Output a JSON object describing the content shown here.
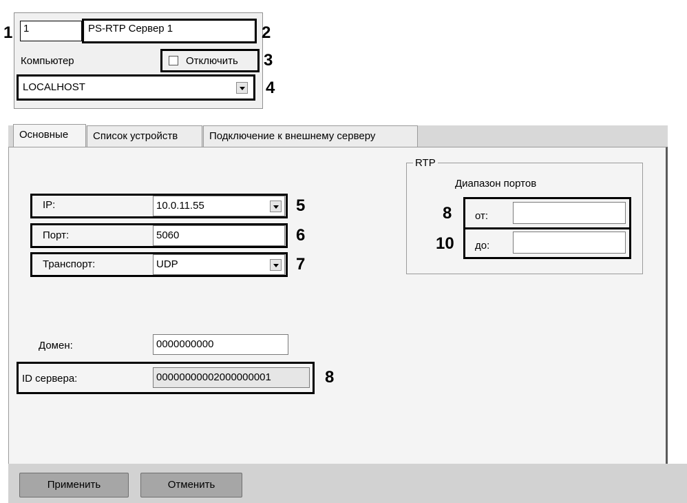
{
  "header": {
    "id_value": "1",
    "name_value": "PS-RTP Сервер 1",
    "computer_label": "Компьютер",
    "disable_label": "Отключить",
    "computer_value": "LOCALHOST"
  },
  "tabs": [
    {
      "label": "Основные"
    },
    {
      "label": "Список устройств"
    },
    {
      "label": "Подключение к внешнему серверу"
    }
  ],
  "main": {
    "ip_label": "IP:",
    "ip_value": "10.0.11.55",
    "port_label": "Порт:",
    "port_value": "5060",
    "transport_label": "Транспорт:",
    "transport_value": "UDP",
    "domain_label": "Домен:",
    "domain_value": "0000000000",
    "server_id_label": "ID сервера:",
    "server_id_value": "00000000002000000001"
  },
  "rtp": {
    "title": "RTP",
    "range_label": "Диапазон портов",
    "from_label": "от:",
    "from_value": "",
    "to_label": "до:",
    "to_value": ""
  },
  "footer": {
    "apply_label": "Применить",
    "cancel_label": "Отменить"
  },
  "callouts": {
    "c1": "1",
    "c2": "2",
    "c3": "3",
    "c4": "4",
    "c5": "5",
    "c6": "6",
    "c7": "7",
    "c8a": "8",
    "c8b": "8",
    "c10": "10"
  }
}
